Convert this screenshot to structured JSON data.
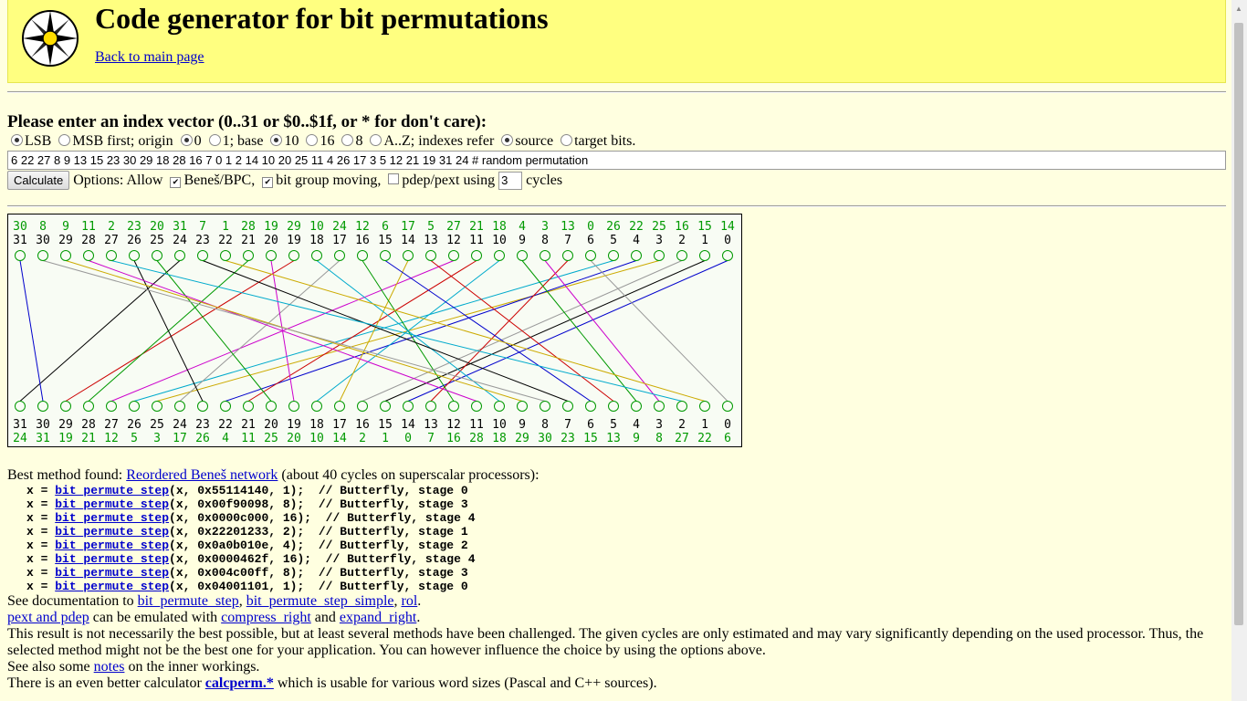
{
  "header": {
    "title": "Code generator for bit permutations",
    "back_link": "Back to main page"
  },
  "form": {
    "prompt": "Please enter an index vector (0..31 or $0..$1f, or * for don't care):",
    "bit_order": {
      "options": [
        "LSB",
        "MSB first"
      ],
      "selected": "LSB"
    },
    "origin_label": "; origin",
    "origin": {
      "options": [
        "0",
        "1"
      ],
      "selected": "0"
    },
    "base_label": "; base",
    "base": {
      "options": [
        "10",
        "16",
        "8",
        "A..Z"
      ],
      "selected": "10"
    },
    "indexes_label": "; indexes refer",
    "refer": {
      "options": [
        "source",
        "target bits."
      ],
      "selected": "source"
    },
    "vector_value": "6 22 27 8 9 13 15 23 30 29 18 28 16 7 0 1 2 14 10 20 25 11 4 26 17 3 5 12 21 19 31 24  # random permutation",
    "calculate_label": "Calculate",
    "options_label": "Options: Allow",
    "opt_benes": {
      "label": "Beneš/BPC,",
      "checked": true
    },
    "opt_bitgroup": {
      "label": "bit group moving,",
      "checked": true
    },
    "opt_pdep": {
      "label": "pdep/pext using",
      "checked": false
    },
    "cycles_value": "3",
    "cycles_label": "cycles"
  },
  "diagram": {
    "source_top_row": [
      "30",
      "8",
      "9",
      "11",
      "2",
      "23",
      "20",
      "31",
      "7",
      "1",
      "28",
      "19",
      "29",
      "10",
      "24",
      "12",
      "6",
      "17",
      "5",
      "27",
      "21",
      "18",
      "4",
      "3",
      "13",
      "0",
      "26",
      "22",
      "25",
      "16",
      "15",
      "14"
    ],
    "bit_positions": [
      "31",
      "30",
      "29",
      "28",
      "27",
      "26",
      "25",
      "24",
      "23",
      "22",
      "21",
      "20",
      "19",
      "18",
      "17",
      "16",
      "15",
      "14",
      "13",
      "12",
      "11",
      "10",
      "9",
      "8",
      "7",
      "6",
      "5",
      "4",
      "3",
      "2",
      "1",
      "0"
    ],
    "target_bottom_row": [
      "24",
      "31",
      "19",
      "21",
      "12",
      "5",
      "3",
      "17",
      "26",
      "4",
      "11",
      "25",
      "20",
      "10",
      "14",
      "2",
      "1",
      "0",
      "7",
      "16",
      "28",
      "18",
      "29",
      "30",
      "23",
      "15",
      "13",
      "9",
      "8",
      "27",
      "22",
      "6"
    ],
    "line_colors": [
      "#000000",
      "#0000cc",
      "#cc0000",
      "#009900",
      "#cc00cc",
      "#00aacc",
      "#ccaa00",
      "#999999"
    ],
    "node_color": "#009900",
    "label_color_green": "#009900"
  },
  "results": {
    "best_prefix": "Best method found:",
    "best_link": "Reordered Beneš network",
    "best_suffix": "(about 40 cycles on superscalar processors):",
    "code_lines": [
      {
        "pre": "x = ",
        "fn": "bit_permute_step",
        "post": "(x, 0x55114140, 1);  // Butterfly, stage 0"
      },
      {
        "pre": "x = ",
        "fn": "bit_permute_step",
        "post": "(x, 0x00f90098, 8);  // Butterfly, stage 3"
      },
      {
        "pre": "x = ",
        "fn": "bit_permute_step",
        "post": "(x, 0x0000c000, 16);  // Butterfly, stage 4"
      },
      {
        "pre": "x = ",
        "fn": "bit_permute_step",
        "post": "(x, 0x22201233, 2);  // Butterfly, stage 1"
      },
      {
        "pre": "x = ",
        "fn": "bit_permute_step",
        "post": "(x, 0x0a0b010e, 4);  // Butterfly, stage 2"
      },
      {
        "pre": "x = ",
        "fn": "bit_permute_step",
        "post": "(x, 0x0000462f, 16);  // Butterfly, stage 4"
      },
      {
        "pre": "x = ",
        "fn": "bit_permute_step",
        "post": "(x, 0x004c00ff, 8);  // Butterfly, stage 3"
      },
      {
        "pre": "x = ",
        "fn": "bit_permute_step",
        "post": "(x, 0x04001101, 1);  // Butterfly, stage 0"
      }
    ],
    "doc_prefix": "See documentation to",
    "doc_link1": "bit_permute_step",
    "doc_link2": "bit_permute_step_simple",
    "doc_link3": "rol",
    "pext_link": "pext and pdep",
    "emulated_text": "can be emulated with",
    "compress_link": "compress_right",
    "and_text": "and",
    "expand_link": "expand_right",
    "disclaimer": "This result is not necessarily the best possible, but at least several methods have been challenged. The given cycles are only estimated and may vary significantly depending on the used processor. Thus, the selected method might not be the best one for your application. You can however influence the choice by using the options above.",
    "notes_prefix": "See also some",
    "notes_link": "notes",
    "notes_suffix": "on the inner workings.",
    "calc_prefix": "There is an even better calculator",
    "calc_link": "calcperm.*",
    "calc_suffix": "which is usable for various word sizes (Pascal and C++ sources)."
  }
}
